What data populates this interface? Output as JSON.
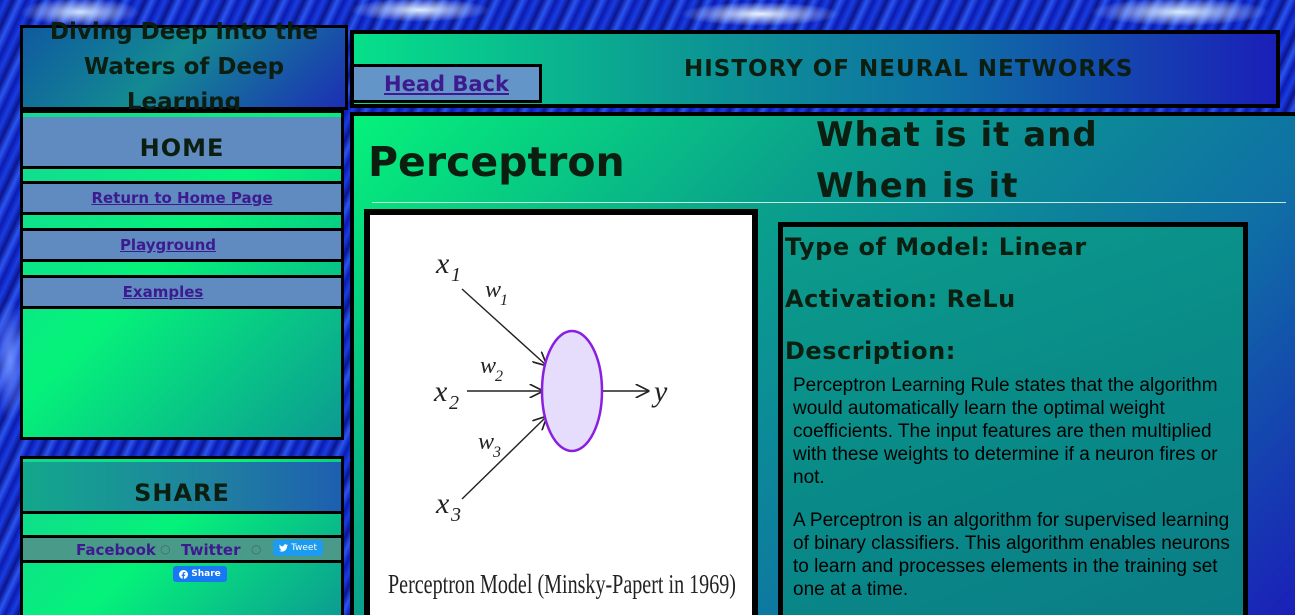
{
  "site": {
    "title_line1": "Diving Deep Into the",
    "title_line2": "Waters of Deep Learning"
  },
  "nav": {
    "home_label": "HOME",
    "items": [
      {
        "label": "Return to Home Page"
      },
      {
        "label": "Playground"
      },
      {
        "label": "Examples"
      }
    ]
  },
  "share": {
    "heading": "SHARE",
    "facebook_label": "Facebook",
    "twitter_label": "Twitter",
    "separator": "○",
    "tweet_button": "Tweet",
    "fb_share_button": "Share"
  },
  "header": {
    "title": "HISTORY OF NEURAL NETWORKS",
    "back_label": "Head Back"
  },
  "main": {
    "page_title": "Perceptron",
    "subtitle_line1": "What is it and",
    "subtitle_line2": "When is it Used?",
    "figure": {
      "caption": "Perceptron Model (Minsky-Papert in 1969)",
      "inputs": [
        "x",
        "x",
        "x"
      ],
      "input_subscripts": [
        "1",
        "2",
        "3"
      ],
      "weights": [
        "w",
        "w",
        "w"
      ],
      "weight_subscripts": [
        "1",
        "2",
        "3"
      ],
      "output": "y",
      "node_fill": "#e6dcfb",
      "node_stroke": "#8a1fe0"
    },
    "info": {
      "model_type": "Type of Model: Linear",
      "activation": "Activation: ReLu",
      "description_heading": "Description:",
      "paragraph1": "Perceptron Learning Rule states that the algorithm would automatically learn the optimal weight coefficients. The input features are then multiplied with these weights to determine if a neuron fires or not.",
      "paragraph2": "A Perceptron is an algorithm for supervised learning of binary classifiers. This algorithm enables neurons to learn and processes elements in the training set one at a time."
    }
  }
}
